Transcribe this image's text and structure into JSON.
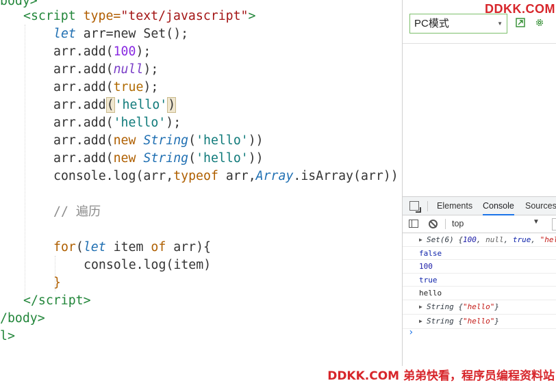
{
  "editor": {
    "lines": {
      "l0": "body>",
      "l1_open": "<script",
      "l1_attr": " type=",
      "l1_val": "\"text/javascript\"",
      "l1_close": ">",
      "l2_kw": "let",
      "l2_rest": " arr=new Set();",
      "l3_a": "arr.add(",
      "l3_n": "100",
      "l3_b": ");",
      "l4_a": "arr.add(",
      "l4_n": "null",
      "l4_b": ");",
      "l5_a": "arr.add(",
      "l5_n": "true",
      "l5_b": ");",
      "l6_a": "arr.add",
      "l6_p1": "(",
      "l6_s": "'hello'",
      "l6_p2": ")",
      "l7_a": "arr.add(",
      "l7_s": "'hello'",
      "l7_b": ");",
      "l8_a": "arr.add(",
      "l8_new": "new ",
      "l8_cls": "String",
      "l8_p": "(",
      "l8_s": "'hello'",
      "l8_b": "))",
      "l9_a": "arr.add(",
      "l9_new": "new ",
      "l9_cls": "String",
      "l9_p": "(",
      "l9_s": "'hello'",
      "l9_b": "))",
      "l10_a": "console.log(arr,",
      "l10_typeof": "typeof",
      "l10_b": " arr,",
      "l10_cls": "Array",
      "l10_c": ".isArray(arr))",
      "l12": "// 遍历",
      "l14_for": "for",
      "l14_p": "(",
      "l14_let": "let",
      "l14_b": " item ",
      "l14_of": "of",
      "l14_c": " arr){",
      "l15": "console.log(item)",
      "l16": "}",
      "l17_open": "</",
      "l17_tag": "script",
      "l17_close": ">",
      "l18": "/body>",
      "l19": "l>"
    }
  },
  "emulation": {
    "mode_label": "PC模式",
    "open_icon": "open-external-icon",
    "settings_icon": "gear-icon"
  },
  "watermark_top": "DDKK.COM",
  "devtools": {
    "tabs": [
      "Elements",
      "Console",
      "Sources"
    ],
    "active_tab": "Console",
    "context": "top"
  },
  "console": {
    "set_line": {
      "prefix": "Set(6) {",
      "v1": "100",
      "s1": ", ",
      "v2": "null",
      "s2": ", ",
      "v3": "true",
      "s3": ", ",
      "v4": "\"hel"
    },
    "false_line": "false",
    "line_100": "100",
    "line_true": "true",
    "line_hello": "hello",
    "string1_prefix": "String {",
    "string1_val": "\"hello\"",
    "string1_suffix": "}",
    "string2_prefix": "String {",
    "string2_val": "\"hello\"",
    "string2_suffix": "}",
    "prompt": "›"
  },
  "watermark_bottom": "DDKK.COM 弟弟快看，程序员编程资料站",
  "colors": {
    "watermark": "#d7262b",
    "active_tab_underline": "#1a73e8",
    "select_border": "#7bbf6a"
  }
}
